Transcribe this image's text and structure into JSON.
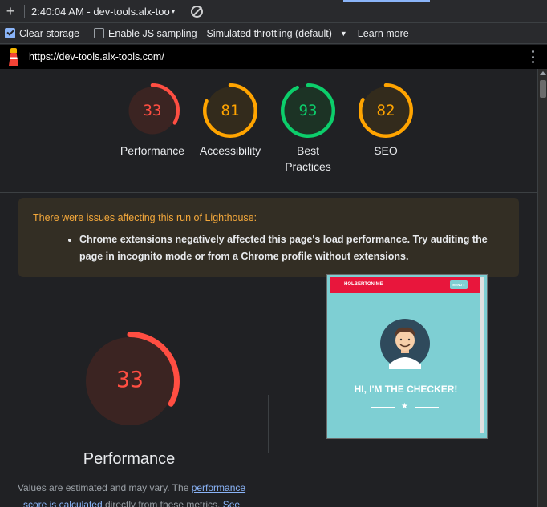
{
  "toolbar": {
    "plus_glyph": "+",
    "session": "2:40:04 AM - dev-tools.alx-too",
    "session_caret": "▾"
  },
  "options": {
    "clear_storage": {
      "label": "Clear storage",
      "checked": true
    },
    "js_sampling": {
      "label": "Enable JS sampling",
      "checked": false
    },
    "throttling": "Simulated throttling (default)",
    "throttling_caret": "▼",
    "learn_more": "Learn more"
  },
  "url_bar": {
    "url": "https://dev-tools.alx-tools.com/"
  },
  "gauges": [
    {
      "label": "Performance",
      "score": "33",
      "value": 33,
      "color": "#ff4e42",
      "bg": "#3b2422"
    },
    {
      "label": "Accessibility",
      "score": "81",
      "value": 81,
      "color": "#ffa400",
      "bg": "#332b1c"
    },
    {
      "label": "Best\nPractices",
      "score": "93",
      "value": 93,
      "color": "#0cce6b",
      "bg": "#1c3325"
    },
    {
      "label": "SEO",
      "score": "82",
      "value": 82,
      "color": "#ffa400",
      "bg": "#332b1c"
    }
  ],
  "warning": {
    "title": "There were issues affecting this run of Lighthouse:",
    "items": [
      "Chrome extensions negatively affected this page's load performance. Try auditing the page in incognito mode or from a Chrome profile without extensions."
    ]
  },
  "performance": {
    "score": "33",
    "value": 33,
    "title": "Performance",
    "desc_1": "Values are estimated and may vary. The ",
    "desc_link": "performance score is calculated",
    "desc_2": " directly from these metrics. ",
    "desc_see": "See"
  },
  "thumbnail": {
    "brand": "HOLBERTON ME",
    "menu": "MENU ≡",
    "hero": "HI, I'M THE CHECKER!",
    "star": "★"
  }
}
